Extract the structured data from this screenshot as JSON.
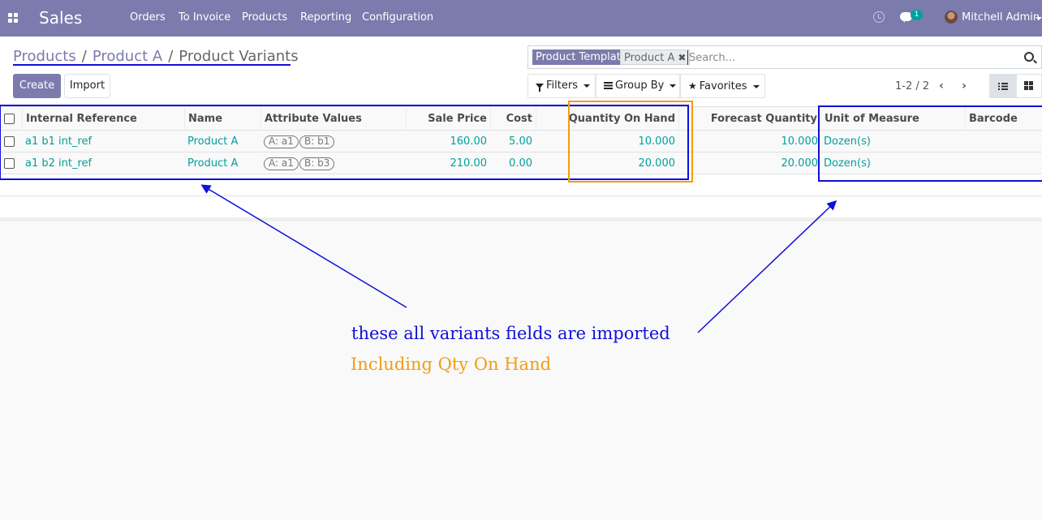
{
  "navbar": {
    "brand": "Sales",
    "menu": [
      "Orders",
      "To Invoice",
      "Products",
      "Reporting",
      "Configuration"
    ],
    "chat_badge": "1",
    "user_name": "Mitchell Admin"
  },
  "breadcrumb": {
    "items": [
      "Products",
      "Product A"
    ],
    "separator": "/",
    "current": "Product Variants"
  },
  "buttons": {
    "create": "Create",
    "import": "Import"
  },
  "search": {
    "facet_label": "Product Template",
    "facet_value": "Product A",
    "placeholder": "Search..."
  },
  "dropdowns": {
    "filters": "Filters",
    "group_by": "Group By",
    "favorites": "Favorites"
  },
  "pager": {
    "value": "1-2 / 2"
  },
  "table": {
    "columns": [
      "Internal Reference",
      "Name",
      "Attribute Values",
      "Sale Price",
      "Cost",
      "Quantity On Hand",
      "Forecast Quantity",
      "Unit of Measure",
      "Barcode"
    ],
    "rows": [
      {
        "ref": "a1 b1 int_ref",
        "name": "Product A",
        "attrs": [
          "A: a1",
          "B: b1"
        ],
        "sale_price": "160.00",
        "cost": "5.00",
        "qty_on_hand": "10.000",
        "forecast": "10.000",
        "uom": "Dozen(s)",
        "barcode": ""
      },
      {
        "ref": "a1 b2 int_ref",
        "name": "Product A",
        "attrs": [
          "A: a1",
          "B: b3"
        ],
        "sale_price": "210.00",
        "cost": "0.00",
        "qty_on_hand": "20.000",
        "forecast": "20.000",
        "uom": "Dozen(s)",
        "barcode": ""
      }
    ]
  },
  "annotations": {
    "text_1": "these all variants fields are imported",
    "text_2": "Including Qty On Hand",
    "colors": {
      "blue": "#1010d8",
      "orange": "#f39c12"
    }
  },
  "colors": {
    "navbar": "#7c7bad",
    "link": "#01a09d",
    "primary": "#7c7bad"
  }
}
